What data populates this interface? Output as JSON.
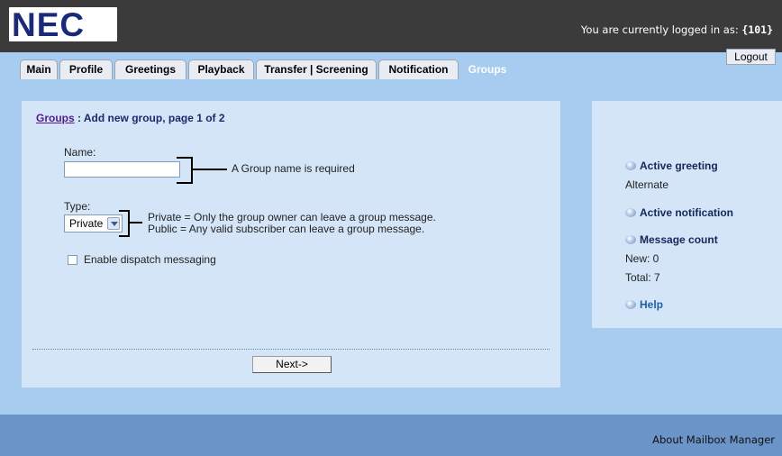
{
  "brand": {
    "logo_text": "NEC"
  },
  "header": {
    "login_prefix": "You are currently logged in as:",
    "login_user": "{101}",
    "logout_label": "Logout"
  },
  "tabs": [
    {
      "label": "Main",
      "active": false
    },
    {
      "label": "Profile",
      "active": false
    },
    {
      "label": "Greetings",
      "active": false
    },
    {
      "label": "Playback",
      "active": false
    },
    {
      "label": "Transfer | Screening",
      "active": false
    },
    {
      "label": "Notification",
      "active": false
    },
    {
      "label": "Groups",
      "active": true
    }
  ],
  "form": {
    "breadcrumb_link": "Groups",
    "breadcrumb_rest": " : Add new group, page 1 of 2",
    "name_label": "Name:",
    "name_value": "",
    "name_note": "A Group name is required",
    "type_label": "Type:",
    "type_selected": "Private",
    "type_note_private": "Private = Only the group owner can leave a group message.",
    "type_note_public": "Public = Any valid subscriber can leave a group message.",
    "dispatch_label": "Enable dispatch messaging",
    "dispatch_checked": false,
    "next_label": "Next->"
  },
  "sidebar": {
    "active_greeting_title": "Active greeting",
    "active_greeting_value": "Alternate",
    "active_notification_title": "Active notification",
    "message_count_title": "Message count",
    "new_count": "New: 0",
    "total_count": "Total: 7",
    "help_label": "Help"
  },
  "footer": {
    "about_label": "About Mailbox Manager"
  },
  "colors": {
    "top_bar": "#3b3b3b",
    "page_bg": "#a8cbf0",
    "panel_bg": "#d4e5f8",
    "footer_bg": "#6b94c8",
    "logo_text": "#1a2a78",
    "help_link": "#1f5fa8"
  },
  "icons": {
    "sidebar_bullet": "orb-icon",
    "select_arrow": "chevron-down-icon"
  }
}
